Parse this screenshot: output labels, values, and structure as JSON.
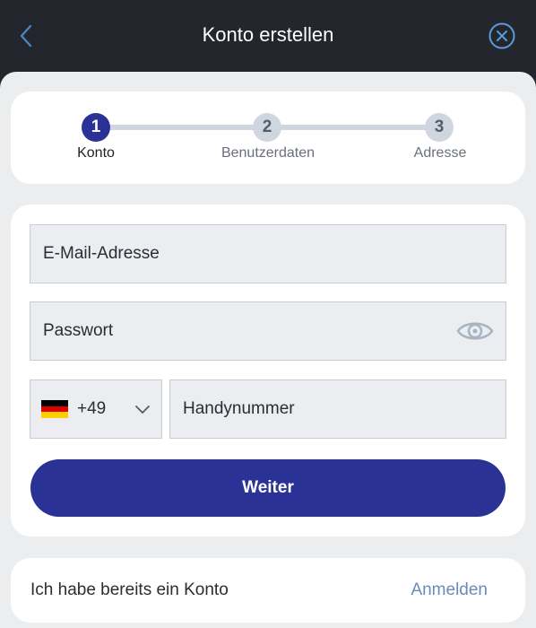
{
  "header": {
    "title": "Konto erstellen",
    "back_icon": "chevron-left-icon",
    "close_icon": "close-circle-icon"
  },
  "stepper": {
    "steps": [
      {
        "number": "1",
        "label": "Konto",
        "state": "active"
      },
      {
        "number": "2",
        "label": "Benutzerdaten",
        "state": "inactive"
      },
      {
        "number": "3",
        "label": "Adresse",
        "state": "inactive"
      }
    ]
  },
  "form": {
    "email_placeholder": "E-Mail-Adresse",
    "password_placeholder": "Passwort",
    "password_toggle_icon": "eye-icon",
    "country_flag": "germany-flag-icon",
    "country_code": "+49",
    "phone_placeholder": "Handynummer",
    "submit_label": "Weiter"
  },
  "login": {
    "prompt": "Ich habe bereits ein Konto",
    "link_label": "Anmelden"
  },
  "colors": {
    "header_bg": "#23262d",
    "accent": "#2b3295",
    "link": "#6a8bb8",
    "back_icon": "#4f86c6",
    "close_icon": "#5a9bd8"
  }
}
